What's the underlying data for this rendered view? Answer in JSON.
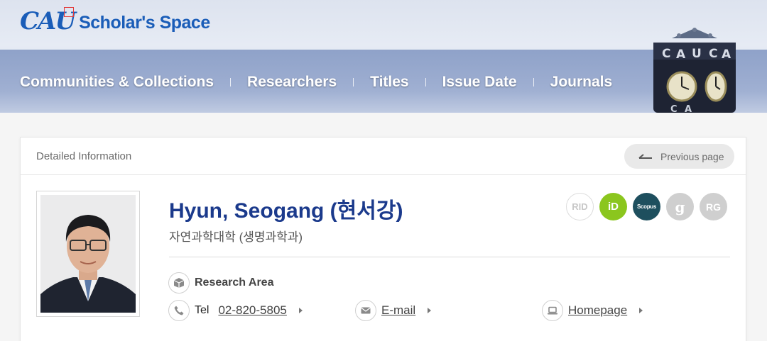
{
  "logo": {
    "mark": "CAU",
    "text": "Scholar's Space"
  },
  "nav": [
    "Communities & Collections",
    "Researchers",
    "Titles",
    "Issue Date",
    "Journals"
  ],
  "tower": {
    "letters": "CAU"
  },
  "card": {
    "header_title": "Detailed Information",
    "prev_button": "Previous page"
  },
  "profile": {
    "name": "Hyun, Seogang (현서강)",
    "department": "자연과학대학 (생명과학과)"
  },
  "badges": {
    "rid": "RID",
    "orcid": "iD",
    "scopus": "Scopus",
    "scholar": "g",
    "rg": "RG"
  },
  "info": {
    "research_area_label": "Research Area",
    "tel_label": "Tel",
    "tel_value": "02-820-5805",
    "email_label": "E-mail",
    "homepage_label": "Homepage"
  },
  "colors": {
    "brand_blue": "#1a5db8",
    "name_blue": "#1b3a8c",
    "orcid_green": "#8bc61e",
    "scopus_teal": "#1e4f5e"
  }
}
